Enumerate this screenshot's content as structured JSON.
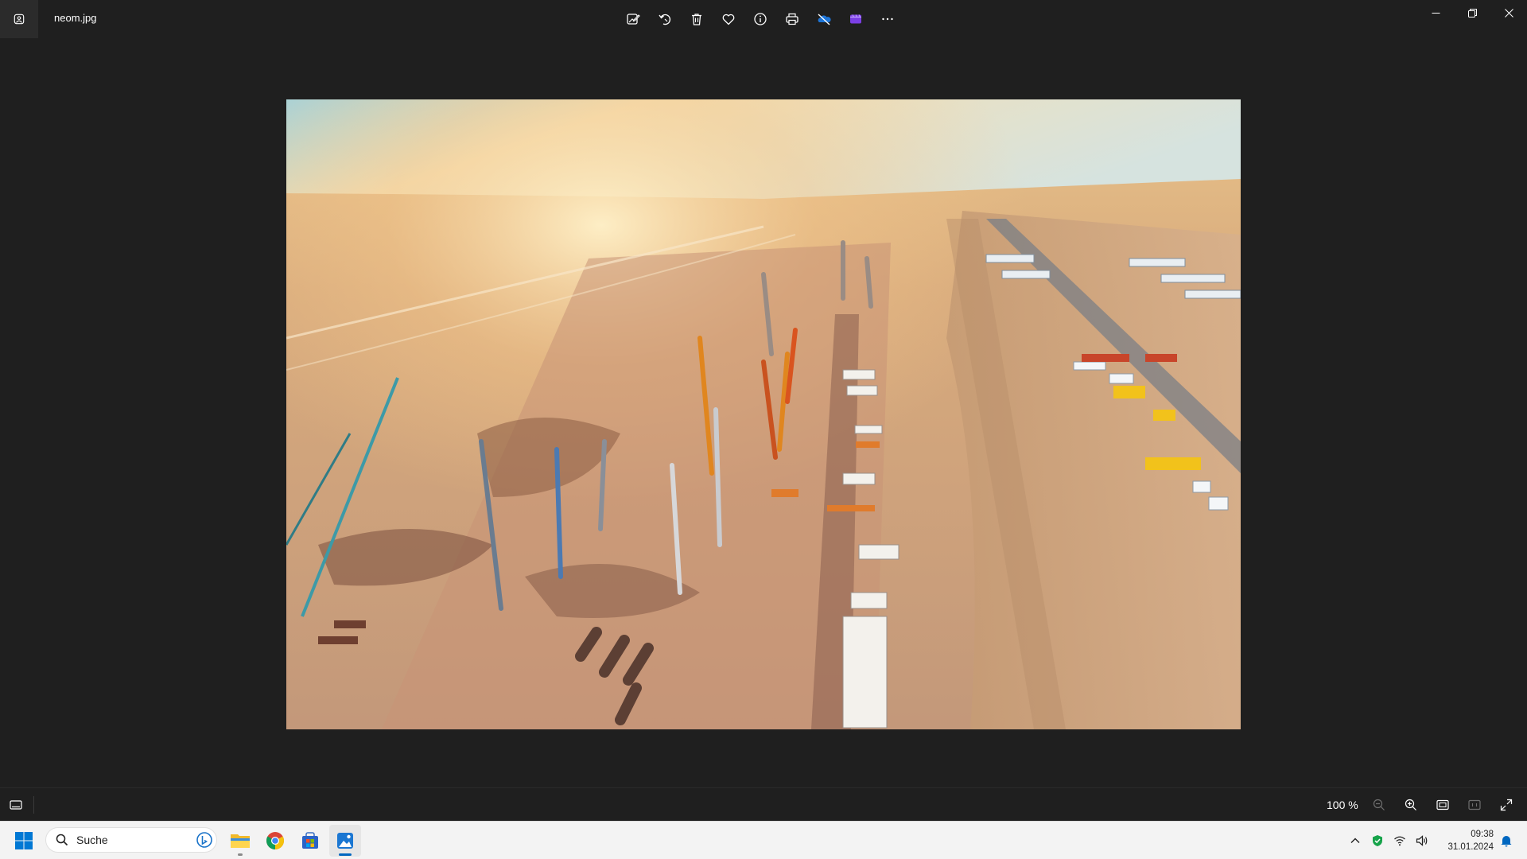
{
  "window": {
    "file_name": "neom.jpg"
  },
  "toolbar": {
    "items": [
      {
        "icon": "edit-image-icon"
      },
      {
        "icon": "rotate-icon"
      },
      {
        "icon": "delete-icon"
      },
      {
        "icon": "favorite-heart-icon"
      },
      {
        "icon": "file-info-icon"
      },
      {
        "icon": "print-icon"
      },
      {
        "icon": "onedrive-icon"
      },
      {
        "icon": "clipchamp-icon"
      },
      {
        "icon": "more-options-icon"
      }
    ]
  },
  "photo": {
    "subject": "neom.jpg"
  },
  "statusbar": {
    "zoom_level": "100 %"
  },
  "taskbar": {
    "search_placeholder": "Suche",
    "time": "09:38",
    "date": "31.01.2024",
    "apps": [
      "file-explorer-icon",
      "chrome-icon",
      "microsoft-store-icon",
      "photos-app-icon"
    ]
  },
  "colors": {
    "app_background": "#1f1f1f",
    "taskbar_background": "#f3f3f3",
    "accent": "#0067c0",
    "security_ok": "#16a34a"
  }
}
